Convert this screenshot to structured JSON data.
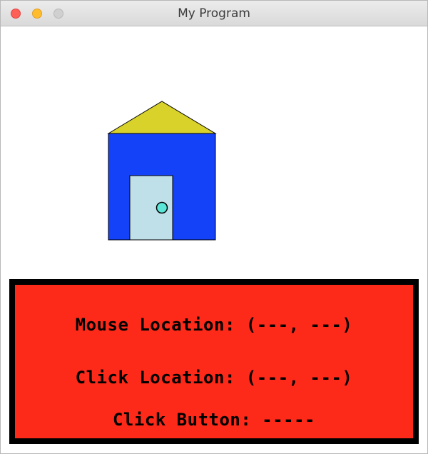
{
  "window": {
    "title": "My Program"
  },
  "colors": {
    "roof": "#d8d22a",
    "house_body": "#1442f8",
    "door": "#bfe0e8",
    "doorknob": "#5be6d8",
    "panel_bg": "#fd2a19",
    "panel_border": "#000000"
  },
  "readouts": {
    "mouse_label": "Mouse Location: (---, ---)",
    "click_label": "Click Location: (---, ---)",
    "button_label": "Click Button: -----"
  }
}
